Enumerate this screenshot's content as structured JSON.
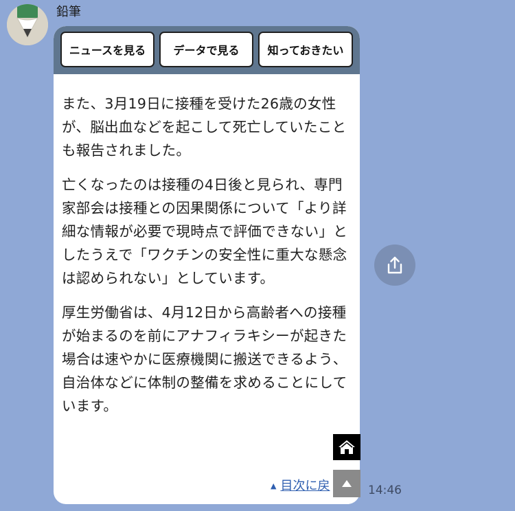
{
  "sender": {
    "name": "鉛筆"
  },
  "message": {
    "actions": [
      {
        "label": "ニュースを見る"
      },
      {
        "label": "データで見る"
      },
      {
        "label": "知っておきたい"
      }
    ],
    "paragraphs": [
      "また、3月19日に接種を受けた26歳の女性が、脳出血などを起こして死亡していたことも報告されました。",
      "亡くなったのは接種の4日後と見られ、専門家部会は接種との因果関係について「より詳細な情報が必要で現時点で評価できない」としたうえで「ワクチンの安全性に重大な懸念は認められない」としています。",
      "厚生労働省は、4月12日から高齢者への接種が始まるのを前にアナフィラキシーが起きた場合は速やかに医療機関に搬送できるよう、自治体などに体制の整備を求めることにしています。"
    ],
    "toc_link": "目次に戻",
    "timestamp": "14:46"
  },
  "icons": {
    "avatar": "pencil-avatar-icon",
    "home": "home-icon",
    "back_to_top": "arrow-up-icon",
    "share": "share-icon"
  },
  "colors": {
    "background": "#8fa8d6",
    "header": "#5f768f",
    "link": "#2f5fb0",
    "avatar_green": "#3f8a55"
  }
}
